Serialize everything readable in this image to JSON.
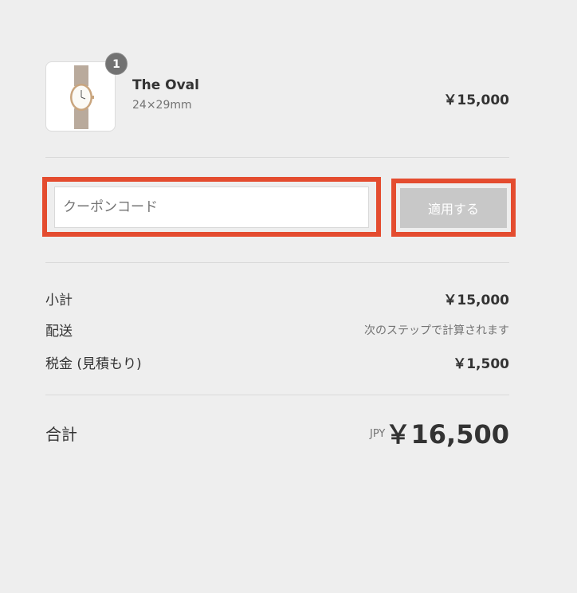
{
  "product": {
    "quantity": "1",
    "name": "The Oval",
    "variant": "24×29mm",
    "price": "￥15,000"
  },
  "coupon": {
    "placeholder": "クーポンコード",
    "value": "",
    "apply_label": "適用する"
  },
  "summary": {
    "subtotal_label": "小計",
    "subtotal_value": "￥15,000",
    "shipping_label": "配送",
    "shipping_value": "次のステップで計算されます",
    "tax_label": "税金 (見積もり)",
    "tax_value": "￥1,500"
  },
  "total": {
    "label": "合計",
    "currency": "JPY",
    "value": "￥16,500"
  },
  "colors": {
    "highlight": "#e44c2f",
    "background": "#eeeeee",
    "apply_button": "#c8c8c8",
    "badge": "#727272"
  },
  "icons": {
    "product_image": "watch-icon"
  }
}
